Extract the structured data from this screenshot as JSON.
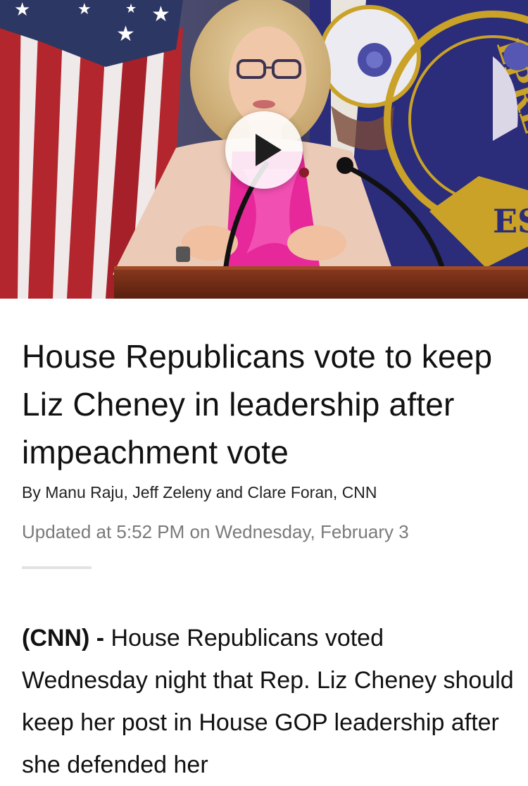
{
  "video": {
    "play_label": "Play video"
  },
  "article": {
    "headline": "House Republicans vote to keep Liz Cheney in leadership after impeachment vote",
    "byline": "By Manu Raju, Jeff Zeleny and Clare Foran, CNN",
    "timestamp": "Updated at 5:52 PM on Wednesday, February 3",
    "lead": "(CNN) -",
    "body": "House Republicans voted Wednesday night that Rep. Liz Cheney should keep her post in House GOP leadership after she defended her"
  },
  "colors": {
    "headline": "#111111",
    "timestamp": "#7a7a7a",
    "divider": "#e2e2e2",
    "seal_blue": "#2b2c7a",
    "seal_gold": "#c9a227",
    "flag_red": "#b3262d"
  }
}
